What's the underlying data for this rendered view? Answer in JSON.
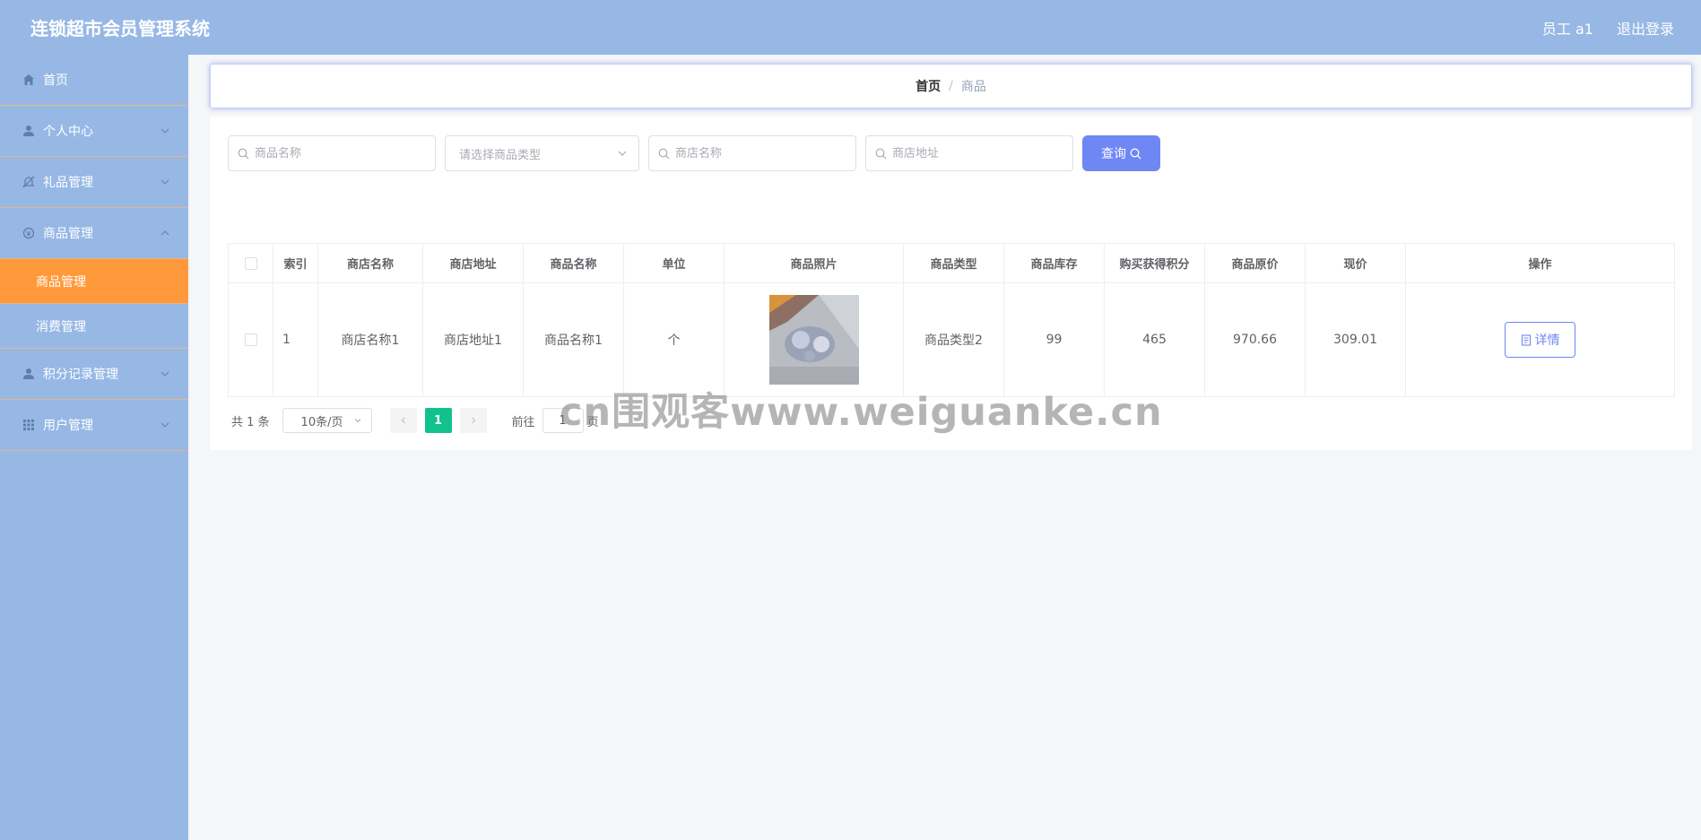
{
  "header": {
    "title": "连锁超市会员管理系统",
    "user": "员工 a1",
    "logout": "退出登录"
  },
  "sidebar": {
    "items": [
      {
        "label": "首页",
        "icon": "home-icon"
      },
      {
        "label": "个人中心",
        "icon": "user-icon"
      },
      {
        "label": "礼品管理",
        "icon": "bell-off-icon"
      },
      {
        "label": "商品管理",
        "icon": "goods-icon"
      },
      {
        "label": "积分记录管理",
        "icon": "user-icon"
      },
      {
        "label": "用户管理",
        "icon": "grid-icon"
      }
    ],
    "sub_items": [
      {
        "label": "商品管理"
      },
      {
        "label": "消费管理"
      }
    ]
  },
  "breadcrumb": {
    "home": "首页",
    "separator": "/",
    "current": "商品"
  },
  "search": {
    "goods_name_placeholder": "商品名称",
    "goods_type_placeholder": "请选择商品类型",
    "shop_name_placeholder": "商店名称",
    "shop_address_placeholder": "商店地址",
    "query_label": "查询"
  },
  "table": {
    "headers": [
      "索引",
      "商店名称",
      "商店地址",
      "商品名称",
      "单位",
      "商品照片",
      "商品类型",
      "商品库存",
      "购买获得积分",
      "商品原价",
      "现价",
      "操作"
    ],
    "rows": [
      {
        "index": "1",
        "shop_name": "商店名称1",
        "shop_address": "商店地址1",
        "goods_name": "商品名称1",
        "unit": "个",
        "goods_type": "商品类型2",
        "stock": "99",
        "points": "465",
        "original_price": "970.66",
        "price": "309.01",
        "action_label": "详情"
      }
    ]
  },
  "pagination": {
    "total": "共 1 条",
    "page_size": "10条/页",
    "current_page": "1",
    "goto_label": "前往",
    "goto_value": "1",
    "page_suffix": "页"
  },
  "watermark": "cn围观客www.weiguanke.cn",
  "colors": {
    "header_bg": "#97b8e5",
    "sidebar_active": "#ff9a3c",
    "primary": "#6f87f4",
    "page_active": "#11c28e"
  }
}
